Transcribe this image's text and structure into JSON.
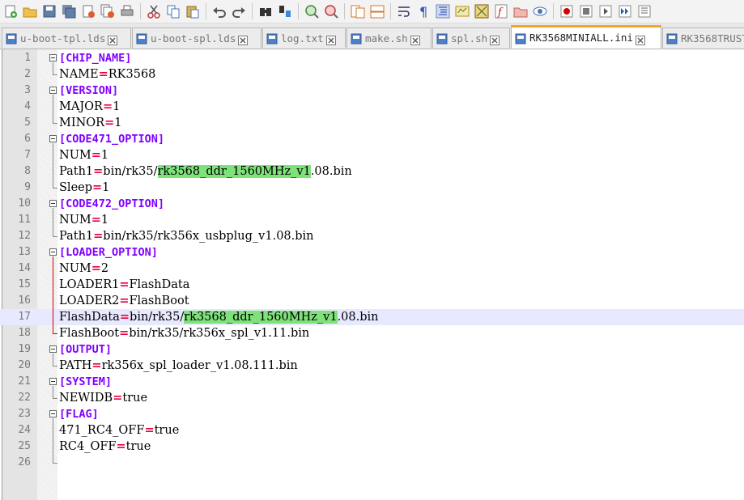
{
  "toolbar": {
    "buttons": [
      "new-file-icon",
      "open-file-icon",
      "save-icon",
      "save-all-icon",
      "close-icon",
      "close-all-icon",
      "print-icon",
      "cut-icon",
      "copy-icon",
      "paste-icon",
      "undo-icon",
      "redo-icon",
      "find-icon",
      "replace-icon",
      "zoom-in-icon",
      "zoom-out-icon",
      "sync-vertical-icon",
      "sync-horizontal-icon",
      "word-wrap-icon",
      "show-all-chars-icon",
      "indent-guide-icon",
      "user-lang-icon",
      "doc-map-icon",
      "function-list-icon",
      "folder-workspace-icon",
      "monitor-icon",
      "record-macro-icon",
      "stop-record-icon",
      "play-macro-icon",
      "run-macro-multiple-icon",
      "save-macro-icon"
    ]
  },
  "tabs": [
    {
      "label": "u-boot-tpl.lds",
      "active": false
    },
    {
      "label": "u-boot-spl.lds",
      "active": false
    },
    {
      "label": "log.txt",
      "active": false
    },
    {
      "label": "make.sh",
      "active": false
    },
    {
      "label": "spl.sh",
      "active": false
    },
    {
      "label": "RK3568MINIALL.ini",
      "active": true
    },
    {
      "label": "RK3568TRUST",
      "active": false
    }
  ],
  "editor": {
    "current_line": 17,
    "lines": [
      {
        "n": "1",
        "kind": "section",
        "text": "[CHIP_NAME]"
      },
      {
        "n": "2",
        "kind": "kv",
        "key": "NAME",
        "eq": "=",
        "val": "RK3568"
      },
      {
        "n": "3",
        "kind": "section",
        "text": "[VERSION]"
      },
      {
        "n": "4",
        "kind": "kv",
        "key": "MAJOR",
        "eq": "=",
        "val": "1"
      },
      {
        "n": "5",
        "kind": "kv",
        "key": "MINOR",
        "eq": "=",
        "val": "1"
      },
      {
        "n": "6",
        "kind": "section",
        "text": "[CODE471_OPTION]"
      },
      {
        "n": "7",
        "kind": "kv",
        "key": "NUM",
        "eq": "=",
        "val": "1"
      },
      {
        "n": "8",
        "kind": "kvhl",
        "key": "Path1",
        "eq": "=",
        "val_pre": "bin/rk35/",
        "val_hl": "rk3568_ddr_1560MHz_v1",
        "val_post": ".08.bin"
      },
      {
        "n": "9",
        "kind": "kv",
        "key": "Sleep",
        "eq": "=",
        "val": "1"
      },
      {
        "n": "10",
        "kind": "section",
        "text": "[CODE472_OPTION]"
      },
      {
        "n": "11",
        "kind": "kv",
        "key": "NUM",
        "eq": "=",
        "val": "1"
      },
      {
        "n": "12",
        "kind": "kv",
        "key": "Path1",
        "eq": "=",
        "val": "bin/rk35/rk356x_usbplug_v1.08.bin"
      },
      {
        "n": "13",
        "kind": "section",
        "text": "[LOADER_OPTION]"
      },
      {
        "n": "14",
        "kind": "kv",
        "key": "NUM",
        "eq": "=",
        "val": "2"
      },
      {
        "n": "15",
        "kind": "kv",
        "key": "LOADER1",
        "eq": "=",
        "val": "FlashData"
      },
      {
        "n": "16",
        "kind": "kv",
        "key": "LOADER2",
        "eq": "=",
        "val": "FlashBoot"
      },
      {
        "n": "17",
        "kind": "kvhl",
        "key": "FlashData",
        "eq": "=",
        "val_pre": "bin/rk35/",
        "val_hl": "rk3568_ddr_1560MHz_v1",
        "val_post": ".08.bin"
      },
      {
        "n": "18",
        "kind": "kv",
        "key": "FlashBoot",
        "eq": "=",
        "val": "bin/rk35/rk356x_spl_v1.11.bin"
      },
      {
        "n": "19",
        "kind": "section",
        "text": "[OUTPUT]"
      },
      {
        "n": "20",
        "kind": "kv",
        "key": "PATH",
        "eq": "=",
        "val": "rk356x_spl_loader_v1.08.111.bin"
      },
      {
        "n": "21",
        "kind": "section",
        "text": "[SYSTEM]"
      },
      {
        "n": "22",
        "kind": "kv",
        "key": "NEWIDB",
        "eq": "=",
        "val": "true"
      },
      {
        "n": "23",
        "kind": "section",
        "text": "[FLAG]"
      },
      {
        "n": "24",
        "kind": "kv",
        "key": "471_RC4_OFF",
        "eq": "=",
        "val": "true"
      },
      {
        "n": "25",
        "kind": "kv",
        "key": "RC4_OFF",
        "eq": "=",
        "val": "true"
      },
      {
        "n": "26",
        "kind": "empty"
      }
    ]
  },
  "colors": {
    "section": "#8000ff",
    "operator": "#e8003c",
    "highlight": "#7ee27a",
    "active_tab_accent": "#f5a623",
    "current_line": "#e8e8ff"
  }
}
